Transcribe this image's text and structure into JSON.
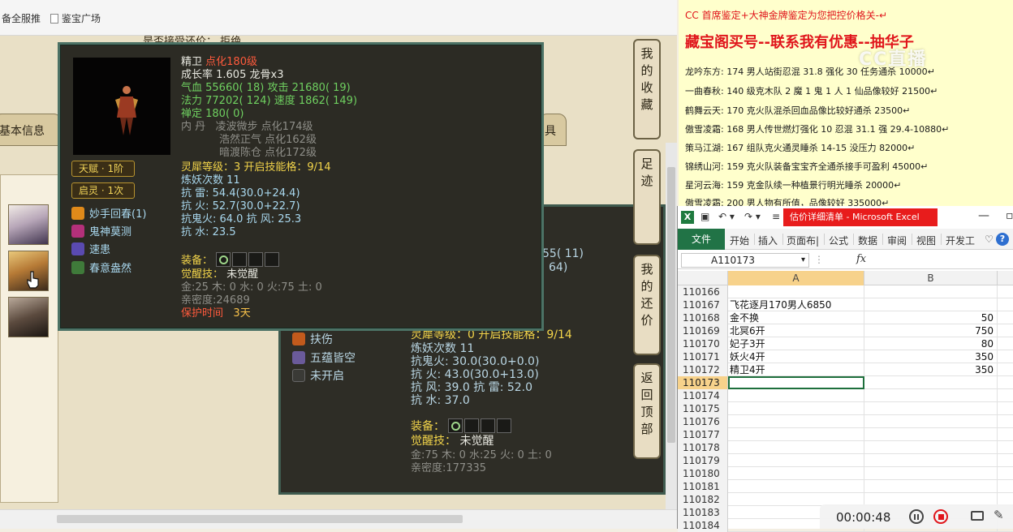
{
  "browser": {
    "bookmarks": [
      "备全服推",
      "鉴宝广场"
    ]
  },
  "game": {
    "header_text": "是否接受还价：    拒绝",
    "tabs": [
      "基本信息",
      "具"
    ],
    "vertical_buttons": [
      "我的收藏",
      "足迹",
      "我的还价",
      "返回顶部"
    ]
  },
  "tooltip": {
    "name": "精卫",
    "level": "点化180级",
    "growth_label": "成长率 1.605",
    "growth_extra": "龙骨x3",
    "hp": "气血 55660( 18)",
    "atk": "攻击 21680( 19)",
    "mp": "法力 77202( 124)",
    "spd": "速度 1862( 149)",
    "zen": "禅定 180( 0)",
    "neidan_label": "内   丹",
    "neidan_1": "凌波微步 点化174级",
    "neidan_2": "浩然正气 点化162级",
    "neidan_3": "暗渡陈仓 点化172级",
    "lingxi": "灵犀等级：3 开启技能格：9/14",
    "lianyao": "炼妖次数 11",
    "res_1": "抗   雷: 54.4(30.0+24.4)",
    "res_2": "抗   火: 52.7(30.0+22.7)",
    "res_3": "抗鬼火: 64.0 抗   风: 25.3",
    "res_4": "抗   水: 23.5",
    "equip_label": "装备：",
    "awaken_label": "觉醒技：",
    "awaken_value": "未觉醒",
    "elements": "金:25 木: 0 水: 0 火:75 土: 0",
    "intimacy": "亲密度:24689",
    "protect_label": "保护时间",
    "protect_value": "3天",
    "badges": [
      "天赋 · 1阶",
      "启灵 · 1次"
    ],
    "skills": [
      "妙手回春(1)",
      "鬼神莫测",
      "速患",
      "春意盎然"
    ]
  },
  "mid_panel": {
    "partial_1": "55( 11)",
    "partial_2": "64)",
    "lingxi": "灵犀等级：0 开启技能格：9/14",
    "skills": [
      "扶伤",
      "五蕴皆空",
      "未开启"
    ],
    "lianyao": "炼妖次数 11",
    "res_1": "抗鬼火: 30.0(30.0+0.0)",
    "res_2": "抗   火: 43.0(30.0+13.0)",
    "res_3": "抗   风: 39.0 抗   雷: 52.0",
    "res_4": "抗   水: 37.0",
    "equip_label": "装备：",
    "awaken_label": "觉醒技：",
    "awaken_value": "未觉醒",
    "elements": "金:75 木: 0 水:25 火: 0 土: 0",
    "intimacy": "亲密度:177335"
  },
  "notice": {
    "line_1": "CC 首席鉴定+大神金牌鉴定为您把控价格关-↵",
    "line_2": "藏宝阁买号--联系我有优惠--抽华子",
    "watermark": "CC直播",
    "entries": [
      "龙吟东方: 174 男人站街忍混 31.8 强化 30 任务通杀 10000↵",
      "一曲春秋: 140 级克木队 2 魔 1 鬼 1 人 1 仙品像较好 21500↵",
      "鹤舞云天: 170 克火队混杀回血品像比较好通杀 23500↵",
      "傲雪凌霜: 168 男人传世燃灯强化 10 忍混 31.1 强 29.4-10880↵",
      "策马江湖: 167 组队克火通灵睡杀 14-15 没压力 82000↵",
      "锦绣山河: 159 克火队装备宝宝齐全通杀接手可盈利 45000↵",
      "星河云海: 159 克金队续一种植景行明光睡杀 20000↵",
      "傲雪凌霜: 200 男人物有所值，品像较好 335000↵"
    ]
  },
  "excel": {
    "doc_title": "估价详细清单 - Microsoft Excel",
    "ribbon_tabs": [
      "开始",
      "插入",
      "页面布|",
      "公式",
      "数据",
      "审阅",
      "视图",
      "开发工"
    ],
    "file_tab": "文件",
    "name_box": "A110173",
    "fx": "fx",
    "col_headers": [
      "A",
      "B"
    ],
    "rows": [
      {
        "num": "110166",
        "a": "",
        "b": ""
      },
      {
        "num": "110167",
        "a": "飞花逐月170男人6850",
        "b": ""
      },
      {
        "num": "110168",
        "a": "金不换",
        "b": "50"
      },
      {
        "num": "110169",
        "a": "北冥6开",
        "b": "750"
      },
      {
        "num": "110170",
        "a": "妃子3开",
        "b": "80"
      },
      {
        "num": "110171",
        "a": "妖火4开",
        "b": "350"
      },
      {
        "num": "110172",
        "a": "精卫4开",
        "b": "350"
      },
      {
        "num": "110173",
        "a": "",
        "b": ""
      },
      {
        "num": "110174",
        "a": "",
        "b": ""
      },
      {
        "num": "110175",
        "a": "",
        "b": ""
      },
      {
        "num": "110176",
        "a": "",
        "b": ""
      },
      {
        "num": "110177",
        "a": "",
        "b": ""
      },
      {
        "num": "110178",
        "a": "",
        "b": ""
      },
      {
        "num": "110179",
        "a": "",
        "b": ""
      },
      {
        "num": "110180",
        "a": "",
        "b": ""
      },
      {
        "num": "110181",
        "a": "",
        "b": ""
      },
      {
        "num": "110182",
        "a": "",
        "b": ""
      },
      {
        "num": "110183",
        "a": "",
        "b": ""
      },
      {
        "num": "110184",
        "a": "",
        "b": ""
      }
    ],
    "selected_row_index": 7
  },
  "recorder": {
    "time": "00:00:48"
  },
  "colors": {
    "excel_green": "#217346",
    "doc_title_bg": "#e81c1c",
    "tooltip_border": "#4c7265",
    "notice_bg": "#ffffcc"
  }
}
